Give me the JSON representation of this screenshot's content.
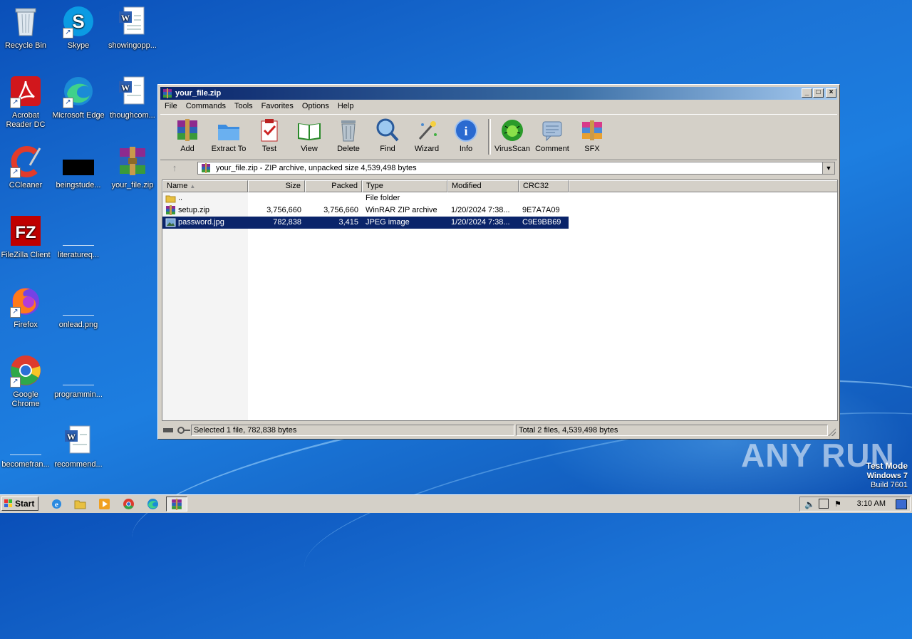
{
  "desktop": {
    "icons": [
      {
        "label": "Recycle Bin"
      },
      {
        "label": "Skype"
      },
      {
        "label": "showingopp..."
      },
      {
        "label": "Acrobat Reader DC"
      },
      {
        "label": "Microsoft Edge"
      },
      {
        "label": "thoughcom..."
      },
      {
        "label": "CCleaner"
      },
      {
        "label": "beingstude..."
      },
      {
        "label": "your_file.zip"
      },
      {
        "label": "FileZilla Client"
      },
      {
        "label": "literatureq..."
      },
      {
        "label": "Firefox"
      },
      {
        "label": "onlead.png"
      },
      {
        "label": "Google Chrome"
      },
      {
        "label": "programmin..."
      },
      {
        "label": "becomefran..."
      },
      {
        "label": "recommend..."
      }
    ]
  },
  "window": {
    "title": "your_file.zip",
    "menu": [
      "File",
      "Commands",
      "Tools",
      "Favorites",
      "Options",
      "Help"
    ],
    "toolbar": [
      "Add",
      "Extract To",
      "Test",
      "View",
      "Delete",
      "Find",
      "Wizard",
      "Info",
      "VirusScan",
      "Comment",
      "SFX"
    ],
    "address": "your_file.zip - ZIP archive, unpacked size 4,539,498 bytes",
    "columns": [
      "Name",
      "Size",
      "Packed",
      "Type",
      "Modified",
      "CRC32"
    ],
    "rows": [
      {
        "name": "..",
        "size": "",
        "packed": "",
        "type": "File folder",
        "modified": "",
        "crc": ""
      },
      {
        "name": "setup.zip",
        "size": "3,756,660",
        "packed": "3,756,660",
        "type": "WinRAR ZIP archive",
        "modified": "1/20/2024 7:38...",
        "crc": "9E7A7A09"
      },
      {
        "name": "password.jpg",
        "size": "782,838",
        "packed": "3,415",
        "type": "JPEG image",
        "modified": "1/20/2024 7:38...",
        "crc": "C9E9BB69"
      }
    ],
    "status_left": "Selected 1 file, 782,838 bytes",
    "status_right": "Total 2 files, 4,539,498 bytes"
  },
  "watermark": "ANY RUN",
  "testmode": {
    "line1": "Test Mode",
    "line2": "Windows 7",
    "line3": "Build 7601"
  },
  "taskbar": {
    "start": "Start",
    "clock": "3:10 AM"
  }
}
